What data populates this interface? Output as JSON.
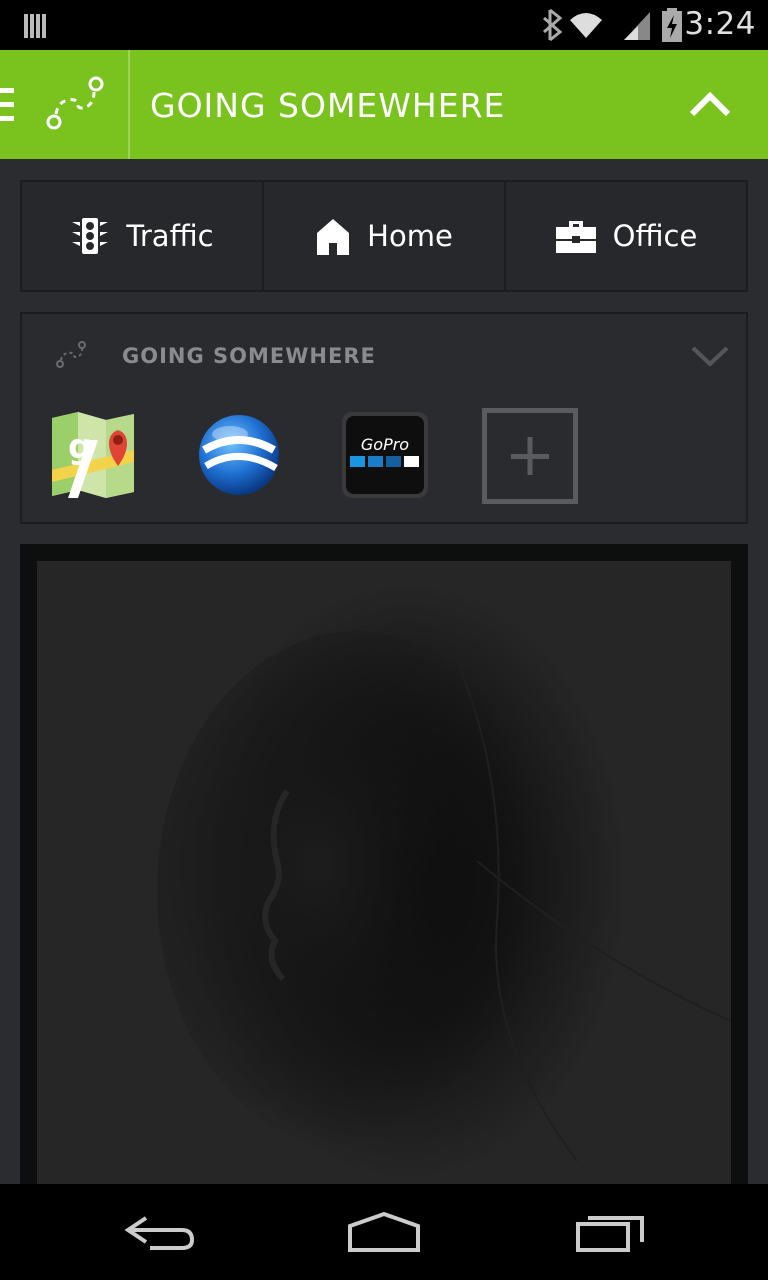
{
  "status_bar": {
    "time": "3:24",
    "icons": [
      "notification-icon",
      "bluetooth-icon",
      "wifi-icon",
      "signal-icon",
      "battery-charging-icon"
    ]
  },
  "header": {
    "title": "GOING SOMEWHERE",
    "accent_color": "#7ac31f"
  },
  "quick_actions": [
    {
      "label": "Traffic",
      "icon": "traffic-light-icon"
    },
    {
      "label": "Home",
      "icon": "home-icon"
    },
    {
      "label": "Office",
      "icon": "briefcase-icon"
    }
  ],
  "card": {
    "title": "GOING SOMEWHERE",
    "apps": [
      {
        "name": "google-maps",
        "icon": "google-maps-icon"
      },
      {
        "name": "google-earth",
        "icon": "google-earth-icon"
      },
      {
        "name": "gopro",
        "icon": "gopro-icon",
        "label": "GoPro"
      }
    ],
    "add_icon": "plus-icon"
  },
  "photo": {
    "icon": "photo-image"
  },
  "nav_bar": {
    "buttons": [
      "back-icon",
      "home-nav-icon",
      "recent-apps-icon"
    ]
  }
}
